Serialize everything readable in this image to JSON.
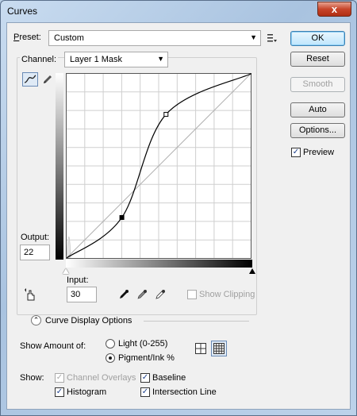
{
  "window": {
    "title": "Curves",
    "close_glyph": "x"
  },
  "preset": {
    "label": "Preset:",
    "value": "Custom",
    "menu_icon": "preset-options-icon"
  },
  "channel": {
    "label": "Channel:",
    "value": "Layer 1 Mask"
  },
  "buttons": {
    "ok": "OK",
    "reset": "Reset",
    "smooth": "Smooth",
    "auto": "Auto",
    "options": "Options..."
  },
  "preview": {
    "label": "Preview",
    "checked": true
  },
  "output": {
    "label": "Output:",
    "value": "22"
  },
  "input": {
    "label": "Input:",
    "value": "30"
  },
  "show_clipping": {
    "label": "Show Clipping",
    "checked": false
  },
  "curve_display_options": {
    "label": "Curve Display Options"
  },
  "show_amount": {
    "label": "Show Amount of:",
    "light_label": "Light  (0-255)",
    "pigment_label": "Pigment/Ink %",
    "selected": "pigment"
  },
  "show": {
    "label": "Show:",
    "channel_overlays": {
      "label": "Channel Overlays",
      "checked": true,
      "enabled": false
    },
    "baseline": {
      "label": "Baseline",
      "checked": true
    },
    "histogram": {
      "label": "Histogram",
      "checked": true
    },
    "intersection_line": {
      "label": "Intersection Line",
      "checked": true
    }
  },
  "curve": {
    "points": [
      [
        0,
        0
      ],
      [
        30,
        22
      ],
      [
        54,
        78
      ],
      [
        100,
        100
      ]
    ]
  }
}
